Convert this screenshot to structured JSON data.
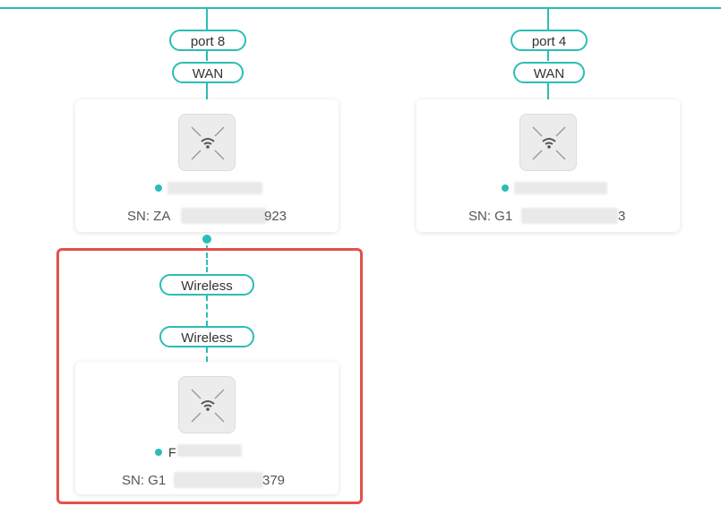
{
  "topology": {
    "left_branch": {
      "port_label": "port 8",
      "uplink_label": "WAN",
      "device": {
        "name_prefix": "",
        "sn_prefix": "SN: ZA",
        "sn_suffix": "923",
        "status": "online"
      }
    },
    "right_branch": {
      "port_label": "port 4",
      "uplink_label": "WAN",
      "device": {
        "sn_prefix": "SN: G1",
        "sn_suffix": "3",
        "status": "online"
      }
    },
    "mesh_child": {
      "link_label_top": "Wireless",
      "link_label_bottom": "Wireless",
      "device": {
        "name_prefix": "F",
        "sn_prefix": "SN: G1",
        "sn_suffix": "379",
        "status": "online"
      }
    }
  },
  "icons": {
    "device": "access-point-icon",
    "status": "status-online-icon"
  },
  "colors": {
    "link": "#2bbdb5",
    "highlight": "#e5504a"
  }
}
